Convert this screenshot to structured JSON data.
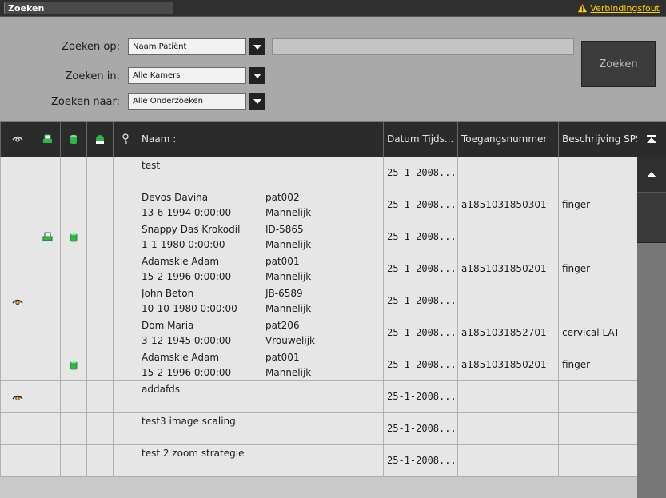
{
  "window": {
    "title": "Zoeken",
    "connection_status": "Verbindingsfout"
  },
  "search": {
    "zoeken_op": {
      "label": "Zoeken op:",
      "value": "Naam Patiënt"
    },
    "zoeken_in": {
      "label": "Zoeken in:",
      "value": "Alle Kamers"
    },
    "zoeken_naar": {
      "label": "Zoeken naar:",
      "value": "Alle Onderzoeken"
    },
    "query": "",
    "button": "Zoeken"
  },
  "table": {
    "headers": {
      "col1_icon": "eye-icon",
      "col2_icon": "printer-icon",
      "col3_icon": "database-icon",
      "col4_icon": "network-icon",
      "col5_icon": "key-icon",
      "name": "Naam :",
      "datum": "Datum Tijds...",
      "toegang": "Toegangsnummer",
      "beschrijving": "Beschrijving SPS"
    },
    "rows": [
      {
        "viewed": false,
        "printed": false,
        "stored": false,
        "name": "test",
        "dob": "",
        "id": "",
        "sex": "",
        "datum": "25-1-2008...",
        "toegang": "",
        "beschrijving": ""
      },
      {
        "viewed": false,
        "printed": false,
        "stored": false,
        "name": "Devos Davina",
        "dob": "13-6-1994 0:00:00",
        "id": "pat002",
        "sex": "Mannelijk",
        "datum": "25-1-2008...",
        "toegang": "a1851031850301",
        "beschrijving": "finger"
      },
      {
        "viewed": false,
        "printed": true,
        "stored": true,
        "name": "Snappy Das Krokodil",
        "dob": "1-1-1980 0:00:00",
        "id": "ID-5865",
        "sex": "Mannelijk",
        "datum": "25-1-2008...",
        "toegang": "",
        "beschrijving": ""
      },
      {
        "viewed": false,
        "printed": false,
        "stored": false,
        "name": "Adamskie Adam",
        "dob": "15-2-1996 0:00:00",
        "id": "pat001",
        "sex": "Mannelijk",
        "datum": "25-1-2008...",
        "toegang": "a1851031850201",
        "beschrijving": "finger"
      },
      {
        "viewed": true,
        "printed": false,
        "stored": false,
        "name": "John Beton",
        "dob": "10-10-1980 0:00:00",
        "id": "JB-6589",
        "sex": "Mannelijk",
        "datum": "25-1-2008...",
        "toegang": "",
        "beschrijving": ""
      },
      {
        "viewed": false,
        "printed": false,
        "stored": false,
        "name": "Dom Maria",
        "dob": "3-12-1945 0:00:00",
        "id": "pat206",
        "sex": "Vrouwelijk",
        "datum": "25-1-2008...",
        "toegang": "a1851031852701",
        "beschrijving": "cervical LAT"
      },
      {
        "viewed": false,
        "printed": false,
        "stored": true,
        "name": "Adamskie Adam",
        "dob": "15-2-1996 0:00:00",
        "id": "pat001",
        "sex": "Mannelijk",
        "datum": "25-1-2008...",
        "toegang": "a1851031850201",
        "beschrijving": "finger"
      },
      {
        "viewed": true,
        "printed": false,
        "stored": false,
        "name": "addafds",
        "dob": "",
        "id": "",
        "sex": "",
        "datum": "25-1-2008...",
        "toegang": "",
        "beschrijving": ""
      },
      {
        "viewed": false,
        "printed": false,
        "stored": false,
        "name": "test3 image scaling",
        "dob": "",
        "id": "",
        "sex": "",
        "datum": "25-1-2008...",
        "toegang": "",
        "beschrijving": ""
      },
      {
        "viewed": false,
        "printed": false,
        "stored": false,
        "name": "test 2 zoom strategie",
        "dob": "",
        "id": "",
        "sex": "",
        "datum": "25-1-2008...",
        "toegang": "",
        "beschrijving": ""
      }
    ]
  },
  "colors": {
    "header_bg": "#2b2b2b",
    "row_bg": "#e6e6e6",
    "warning": "#ffd400",
    "icon_green": "#2fb84a"
  }
}
